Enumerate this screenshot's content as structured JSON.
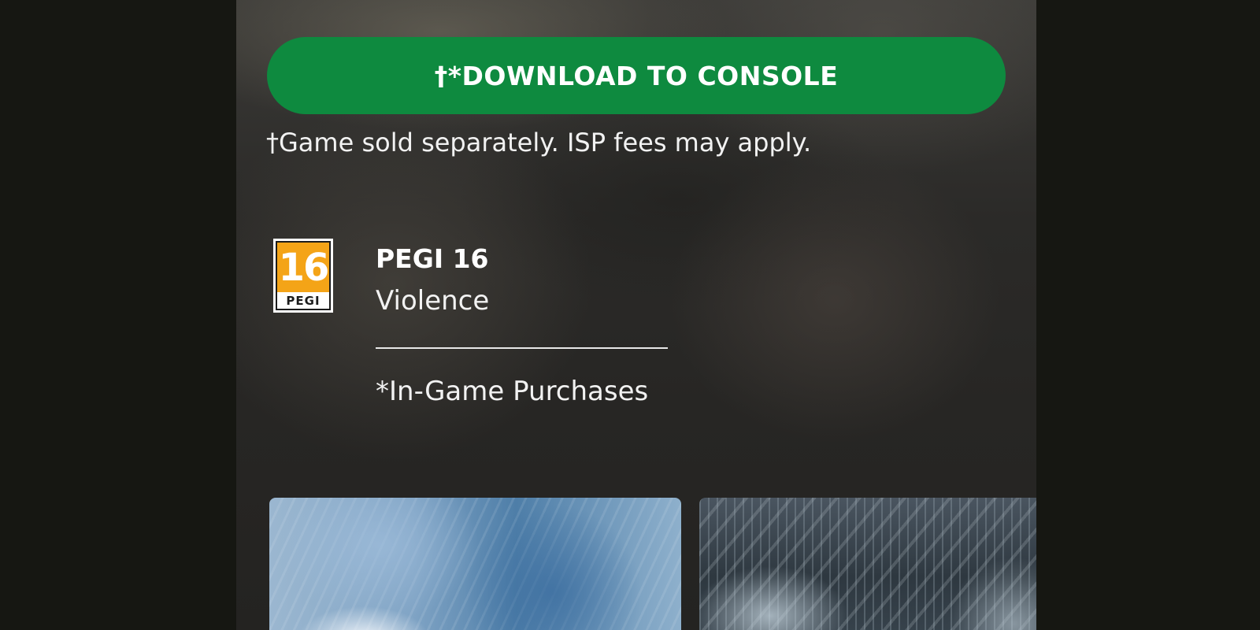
{
  "actions": {
    "download_label": "†*DOWNLOAD TO CONSOLE",
    "disclaimer": "†Game sold separately. ISP fees may apply."
  },
  "rating": {
    "badge_age": "16",
    "badge_org": "PEGI",
    "title": "PEGI 16",
    "descriptor": "Violence",
    "interactive_element": "*In-Game Purchases"
  },
  "colors": {
    "button_green": "#0e8a3f",
    "pegi_orange": "#f4a417",
    "background": "#2b2a28"
  }
}
